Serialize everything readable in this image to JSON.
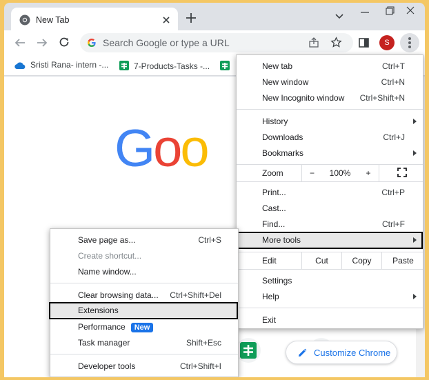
{
  "tab": {
    "title": "New Tab"
  },
  "omnibox": {
    "placeholder": "Search Google or type a URL"
  },
  "profile": {
    "initial": "S",
    "color": "#c5221f"
  },
  "bookmarks": [
    {
      "label": "Sristi Rana- intern -...",
      "icon": "onedrive-icon"
    },
    {
      "label": "7-Products-Tasks -...",
      "icon": "sheets-icon"
    },
    {
      "label": "",
      "icon": "sheets-icon"
    }
  ],
  "google_logo": {
    "letters": [
      "G",
      "o",
      "o"
    ],
    "colors": [
      "#4285f4",
      "#ea4335",
      "#fbbc05"
    ]
  },
  "customize": {
    "label": "Customize Chrome"
  },
  "main_menu": {
    "new_tab": {
      "label": "New tab",
      "shortcut": "Ctrl+T"
    },
    "new_window": {
      "label": "New window",
      "shortcut": "Ctrl+N"
    },
    "incognito": {
      "label": "New Incognito window",
      "shortcut": "Ctrl+Shift+N"
    },
    "history": {
      "label": "History"
    },
    "downloads": {
      "label": "Downloads",
      "shortcut": "Ctrl+J"
    },
    "bookmarks": {
      "label": "Bookmarks"
    },
    "zoom": {
      "label": "Zoom",
      "minus": "−",
      "value": "100%",
      "plus": "+"
    },
    "print": {
      "label": "Print...",
      "shortcut": "Ctrl+P"
    },
    "cast": {
      "label": "Cast..."
    },
    "find": {
      "label": "Find...",
      "shortcut": "Ctrl+F"
    },
    "more_tools": {
      "label": "More tools"
    },
    "edit": {
      "label": "Edit",
      "cut": "Cut",
      "copy": "Copy",
      "paste": "Paste"
    },
    "settings": {
      "label": "Settings"
    },
    "help": {
      "label": "Help"
    },
    "exit": {
      "label": "Exit"
    }
  },
  "sub_menu": {
    "save_page": {
      "label": "Save page as...",
      "shortcut": "Ctrl+S"
    },
    "create_shortcut": {
      "label": "Create shortcut..."
    },
    "name_window": {
      "label": "Name window..."
    },
    "clear_data": {
      "label": "Clear browsing data...",
      "shortcut": "Ctrl+Shift+Del"
    },
    "extensions": {
      "label": "Extensions"
    },
    "performance": {
      "label": "Performance",
      "badge": "New"
    },
    "task_manager": {
      "label": "Task manager",
      "shortcut": "Shift+Esc"
    },
    "dev_tools": {
      "label": "Developer tools",
      "shortcut": "Ctrl+Shift+I"
    }
  },
  "colors": {
    "frame": "#dee1e6",
    "accent": "#1a73e8",
    "desktop": "#f4c764"
  }
}
